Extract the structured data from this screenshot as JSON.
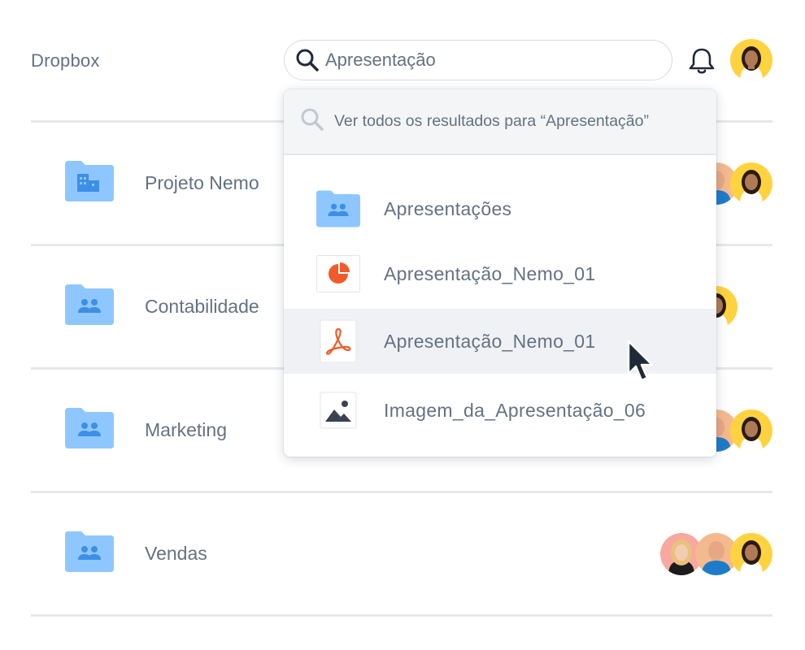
{
  "app": {
    "brand": "Dropbox"
  },
  "search": {
    "value": "Apresentação",
    "icon": "search-icon"
  },
  "header_icons": {
    "notifications": "bell-icon"
  },
  "folders": [
    {
      "label": "Projeto Nemo",
      "icon": "building-folder-icon"
    },
    {
      "label": "Contabilidade",
      "icon": "shared-folder-icon"
    },
    {
      "label": "Marketing",
      "icon": "shared-folder-icon"
    },
    {
      "label": "Vendas",
      "icon": "shared-folder-icon"
    }
  ],
  "dropdown": {
    "see_all": "Ver todos os resultados para “Apresentação”",
    "items": [
      {
        "label": "Apresentações",
        "icon": "shared-folder-icon"
      },
      {
        "label": "Apresentação_Nemo_01",
        "icon": "presentation-file-icon"
      },
      {
        "label": "Apresentação_Nemo_01",
        "icon": "pdf-file-icon"
      },
      {
        "label": "Imagem_da_Apresentação_06",
        "icon": "image-file-icon"
      }
    ],
    "highlighted_index": 2
  },
  "colors": {
    "folder_blue": "#8ec7ff",
    "folder_dark": "#3d8fe6",
    "text": "#637282",
    "accent_red": "#f15a29",
    "avatar_yellow": "#ffd23f",
    "avatar_blue": "#1e7bc9",
    "avatar_pink": "#f7a9a0"
  }
}
